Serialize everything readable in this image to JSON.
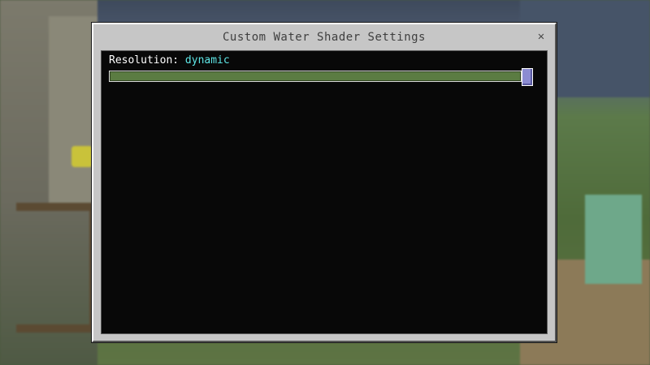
{
  "dialog": {
    "title": "Custom Water Shader Settings",
    "close_icon": "close-icon",
    "close_glyph": "✕"
  },
  "setting": {
    "label": "Resolution:",
    "value": "dynamic",
    "value_color": "#5ee6e6",
    "slider": {
      "value": 1.0,
      "track_color": "#5b7c42",
      "thumb_color": "#8c8cd2"
    }
  }
}
